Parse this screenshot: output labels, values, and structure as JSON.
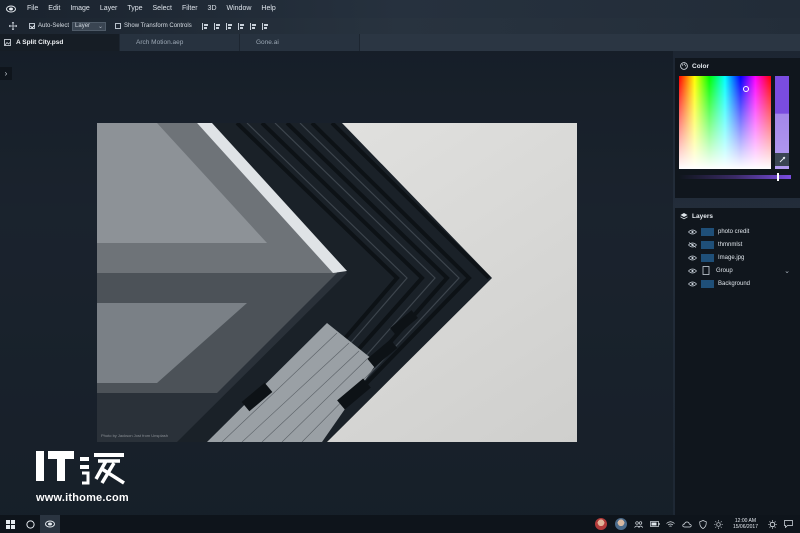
{
  "menu": {
    "items": [
      "File",
      "Edit",
      "Image",
      "Layer",
      "Type",
      "Select",
      "Filter",
      "3D",
      "Window",
      "Help"
    ]
  },
  "options": {
    "auto_select_label": "Auto-Select",
    "auto_select_checked": true,
    "target_select_value": "Layer",
    "show_transform_label": "Show Transform Controls",
    "show_transform_checked": false
  },
  "tabs": [
    {
      "label": "A Split City.psd",
      "active": true
    },
    {
      "label": "Arch Motion.aep",
      "active": false
    },
    {
      "label": "Gone.ai",
      "active": false
    }
  ],
  "canvas": {
    "photo_credit": "Photo by Jackson Jost from Unsplash"
  },
  "color_panel": {
    "title": "Color",
    "current_color": "#7a4ce0"
  },
  "layers_panel": {
    "title": "Layers",
    "layers": [
      {
        "name": "photo credit",
        "visible": true
      },
      {
        "name": "thmnmlst",
        "visible": false
      },
      {
        "name": "Image.jpg",
        "visible": true
      },
      {
        "name": "Group",
        "visible": true,
        "is_group": true
      },
      {
        "name": "Background",
        "visible": true
      }
    ]
  },
  "watermark": {
    "logo_text": "IT之家",
    "url": "www.ithome.com"
  },
  "taskbar": {
    "time": "12:00 AM",
    "date": "15/06/2017"
  }
}
